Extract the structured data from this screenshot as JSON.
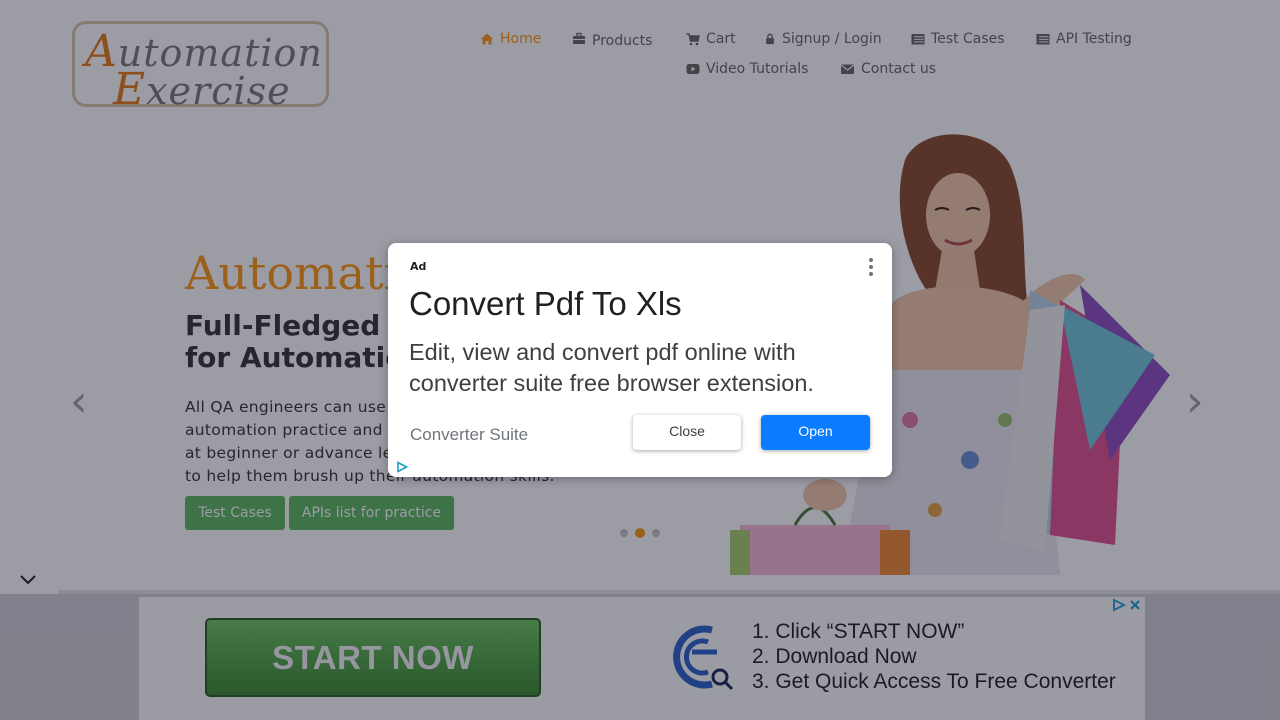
{
  "logo": {
    "line1_cap": "A",
    "line1_rest": "utomation",
    "line2_cap": "E",
    "line2_rest": "xercise"
  },
  "nav": [
    {
      "label": "Home",
      "icon": "home-icon",
      "active": true
    },
    {
      "label": "Products",
      "icon": "briefcase-icon"
    },
    {
      "label": "Cart",
      "icon": "cart-icon"
    },
    {
      "label": "Signup / Login",
      "icon": "lock-icon"
    },
    {
      "label": "Test Cases",
      "icon": "list-icon"
    },
    {
      "label": "API Testing",
      "icon": "list-icon"
    },
    {
      "label": "Video Tutorials",
      "icon": "youtube-icon"
    },
    {
      "label": "Contact us",
      "icon": "envelope-icon"
    }
  ],
  "hero": {
    "title": "AutomationExercise",
    "subtitle_line1": "Full-Fledged practice website",
    "subtitle_line2": "for Automation Engineers",
    "text": "All QA engineers can use this website for automation practice and API testing either they are at beginner or advance level. This is for everybody to help them brush up their automation skills.",
    "btn_test_cases": "Test Cases",
    "btn_apis": "APIs list for practice",
    "prev_arrow": "‹",
    "next_arrow": "›",
    "active_slide": 2,
    "slide_count": 3
  },
  "modal": {
    "ad_label": "Ad",
    "title": "Convert Pdf To Xls",
    "description": "Edit, view and convert pdf online with converter suite free browser extension.",
    "brand": "Converter Suite",
    "close_label": "Close",
    "open_label": "Open"
  },
  "bottom_ad": {
    "start_label": "START NOW",
    "steps": [
      "1. Click “START NOW”",
      "2. Download Now",
      "3. Get Quick Access To Free Converter"
    ]
  },
  "colors": {
    "accent": "#fe980f",
    "green": "#5cb85c",
    "open_blue": "#0a7cff"
  }
}
